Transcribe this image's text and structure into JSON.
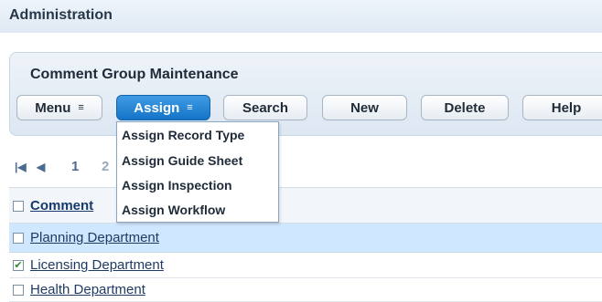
{
  "header": {
    "title": "Administration"
  },
  "panel": {
    "title": "Comment Group Maintenance"
  },
  "toolbar": {
    "menu_label": "Menu",
    "assign_label": "Assign",
    "search_label": "Search",
    "new_label": "New",
    "delete_label": "Delete",
    "help_label": "Help",
    "caret": "≡"
  },
  "assign_menu": {
    "items": [
      "Assign Record Type",
      "Assign Guide Sheet",
      "Assign Inspection",
      "Assign Workflow"
    ]
  },
  "pager": {
    "first": "◀",
    "prev": "◀",
    "page1": "1",
    "page2": "2"
  },
  "table": {
    "header_label": "Comment",
    "rows": [
      {
        "label": "Planning Department",
        "checked": false,
        "selected": true
      },
      {
        "label": "Licensing Department",
        "checked": true,
        "selected": false
      },
      {
        "label": "Health Department",
        "checked": false,
        "selected": false
      }
    ],
    "check_mark": "✔"
  }
}
